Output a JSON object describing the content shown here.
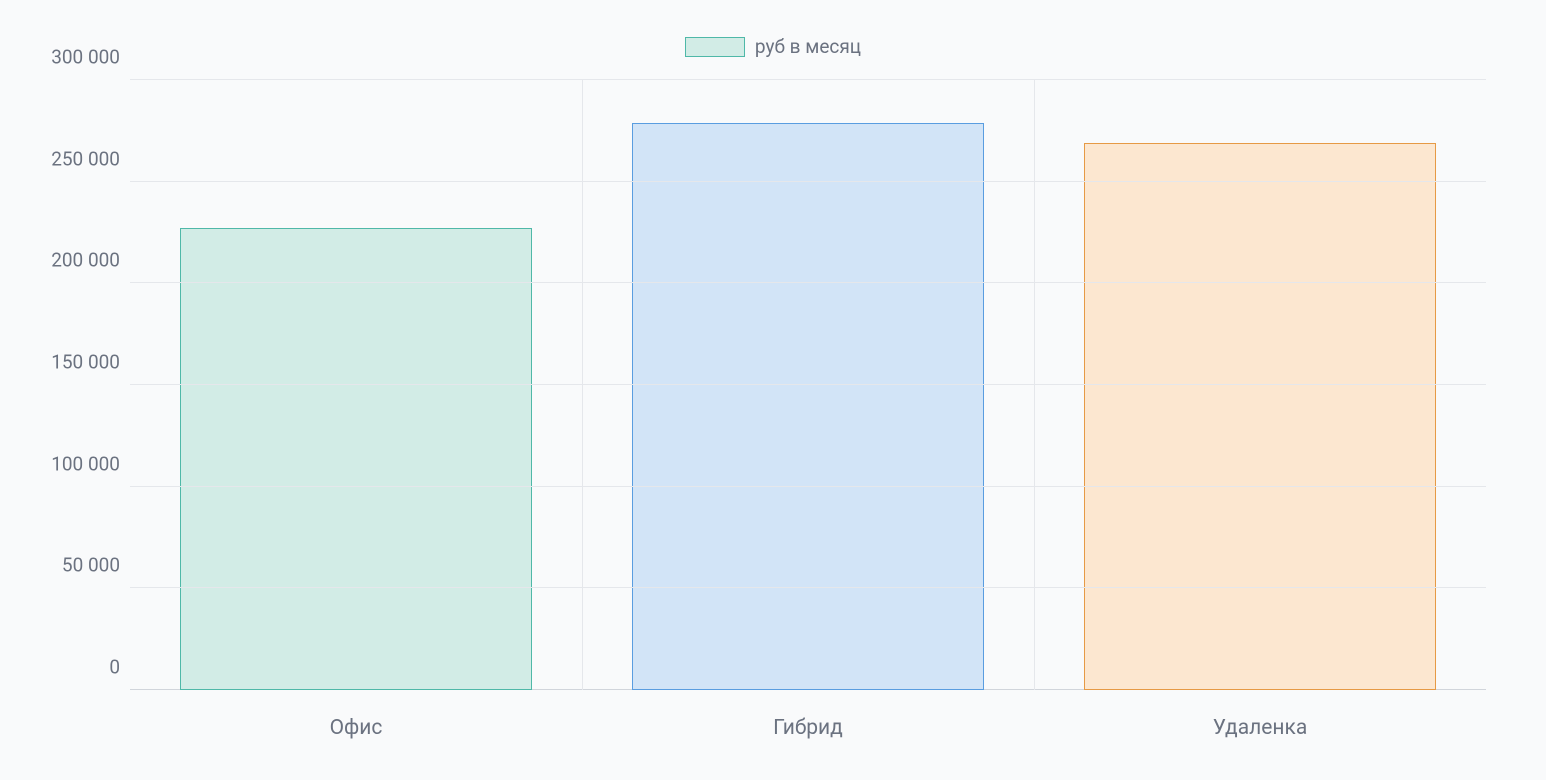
{
  "chart_data": {
    "type": "bar",
    "legend_label": "руб в месяц",
    "categories": [
      "Офис",
      "Гибрид",
      "Удаленка"
    ],
    "values": [
      227000,
      279000,
      269000
    ],
    "yticks": [
      0,
      50000,
      100000,
      150000,
      200000,
      250000,
      300000
    ],
    "ytick_labels": [
      "0",
      "50 000",
      "100 000",
      "150 000",
      "200 000",
      "250 000",
      "300 000"
    ],
    "ylim": [
      0,
      300000
    ],
    "colors": {
      "bar_fill": [
        "#d2ece6",
        "#d2e4f7",
        "#fce7d0"
      ],
      "bar_stroke": [
        "#4fb8a8",
        "#5a9de0",
        "#e69a45"
      ],
      "legend_fill": "#d2ece6",
      "legend_stroke": "#4fb8a8"
    }
  }
}
